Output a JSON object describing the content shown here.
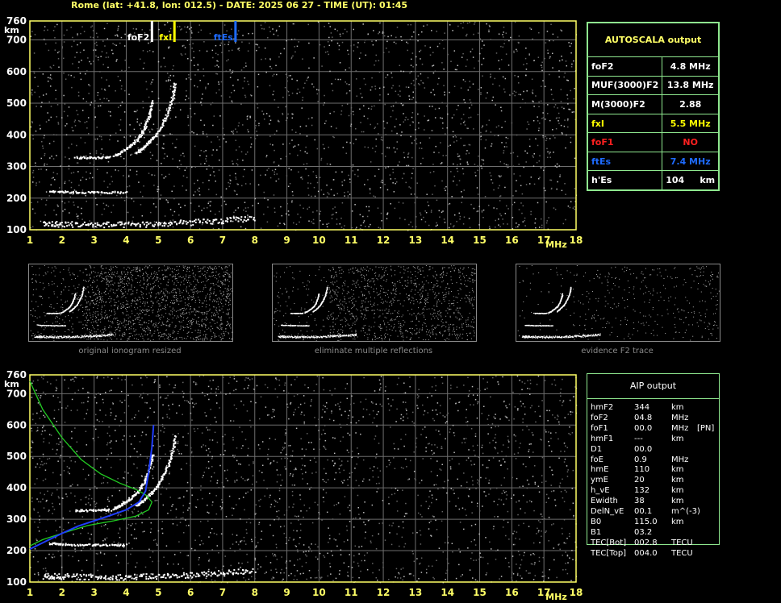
{
  "header": {
    "title": "Rome (lat: +41.8, lon: 012.5) - DATE: 2025 06 27 - TIME (UT): 01:45"
  },
  "colors": {
    "axis": "#ffff66",
    "grid": "#707070",
    "panel_border": "#8fe88f",
    "foF2": "#ffffff",
    "fxI": "#ffff00",
    "ftEs": "#1e6bff",
    "foF1": "#ff2020",
    "profile_green": "#22cc22",
    "profile_blue": "#1f3dff"
  },
  "autoscala": {
    "title": "AUTOSCALA output",
    "rows": [
      {
        "label": "foF2",
        "value": "4.8 MHz",
        "color": "#ffffff"
      },
      {
        "label": "MUF(3000)F2",
        "value": "13.8 MHz",
        "color": "#ffffff"
      },
      {
        "label": "M(3000)F2",
        "value": "2.88",
        "color": "#ffffff"
      },
      {
        "label": "fxI",
        "value": "5.5 MHz",
        "color": "#ffff00"
      },
      {
        "label": "foF1",
        "value": "NO",
        "color": "#ff2020"
      },
      {
        "label": "ftEs",
        "value": "7.4 MHz",
        "color": "#1e6bff"
      },
      {
        "label": "h'Es",
        "value": "104     km",
        "color": "#ffffff"
      }
    ]
  },
  "aip": {
    "title": "AIP output",
    "rows": [
      [
        "hmF2",
        "344",
        "km",
        ""
      ],
      [
        "foF2",
        "04.8",
        "MHz",
        ""
      ],
      [
        "foF1",
        "00.0",
        "MHz",
        "[PN]"
      ],
      [
        "hmF1",
        "---",
        "km",
        ""
      ],
      [
        "D1",
        "00.0",
        "",
        ""
      ],
      [
        "foE",
        "0.9",
        "MHz",
        ""
      ],
      [
        "hmE",
        "110",
        "km",
        ""
      ],
      [
        "ymE",
        "20",
        "km",
        ""
      ],
      [
        "h_vE",
        "132",
        "km",
        ""
      ],
      [
        "Ewidth",
        "38",
        "km",
        ""
      ],
      [
        "DelN_vE",
        "00.1",
        "m^(-3)",
        ""
      ],
      [
        "B0",
        "115.0",
        "km",
        ""
      ],
      [
        "B1",
        "03.2",
        "",
        ""
      ],
      [
        "TEC[Bot]",
        "002.8",
        "TECU",
        ""
      ],
      [
        "TEC[Top]",
        "004.0",
        "TECU",
        ""
      ]
    ]
  },
  "thumbnails": [
    {
      "caption": "original ionogram resized"
    },
    {
      "caption": "eliminate multiple reflections"
    },
    {
      "caption": "evidence F2 trace"
    }
  ],
  "chart_data": [
    {
      "type": "scatter",
      "title": "",
      "xlabel": "MHz",
      "ylabel": "km",
      "xlim": [
        1,
        18
      ],
      "ylim": [
        100,
        760
      ],
      "x_ticks": [
        1,
        2,
        3,
        4,
        5,
        6,
        7,
        8,
        9,
        10,
        11,
        12,
        13,
        14,
        15,
        16,
        17,
        18
      ],
      "y_ticks": [
        100,
        200,
        300,
        400,
        500,
        600,
        700,
        760
      ],
      "markers": [
        {
          "label": "foF2",
          "freq": 4.8,
          "color": "#ffffff"
        },
        {
          "label": "fxI",
          "freq": 5.5,
          "color": "#ffff00"
        },
        {
          "label": "ftEs",
          "freq": 7.4,
          "color": "#1e6bff"
        }
      ],
      "series": [
        {
          "type": "o_trace",
          "points": [
            [
              3.6,
              335
            ],
            [
              3.8,
              345
            ],
            [
              4.0,
              360
            ],
            [
              4.2,
              375
            ],
            [
              4.4,
              395
            ],
            [
              4.55,
              420
            ],
            [
              4.65,
              450
            ],
            [
              4.75,
              480
            ],
            [
              4.8,
              510
            ]
          ]
        },
        {
          "type": "x_trace",
          "points": [
            [
              4.3,
              345
            ],
            [
              4.5,
              360
            ],
            [
              4.7,
              380
            ],
            [
              4.9,
              400
            ],
            [
              5.05,
              425
            ],
            [
              5.2,
              455
            ],
            [
              5.35,
              490
            ],
            [
              5.45,
              530
            ],
            [
              5.5,
              570
            ]
          ]
        },
        {
          "type": "f_low",
          "points": [
            [
              2.4,
              330
            ],
            [
              2.8,
              330
            ],
            [
              3.2,
              330
            ],
            [
              3.5,
              332
            ]
          ]
        },
        {
          "type": "es_band",
          "points": [
            [
              1.6,
              225
            ],
            [
              2.0,
              222
            ],
            [
              2.5,
              220
            ],
            [
              3.0,
              220
            ],
            [
              3.5,
              220
            ],
            [
              4.0,
              220
            ]
          ]
        },
        {
          "type": "e_band",
          "points": [
            [
              1.4,
              120
            ],
            [
              2,
              120
            ],
            [
              3,
              118
            ],
            [
              4,
              118
            ],
            [
              5,
              120
            ],
            [
              6,
              125
            ],
            [
              7,
              130
            ],
            [
              8,
              140
            ]
          ]
        }
      ]
    },
    {
      "type": "line",
      "title": "",
      "xlabel": "MHz",
      "ylabel": "km",
      "xlim": [
        1,
        18
      ],
      "ylim": [
        100,
        760
      ],
      "x_ticks": [
        1,
        2,
        3,
        4,
        5,
        6,
        7,
        8,
        9,
        10,
        11,
        12,
        13,
        14,
        15,
        16,
        17,
        18
      ],
      "y_ticks": [
        100,
        200,
        300,
        400,
        500,
        600,
        700,
        760
      ],
      "series": [
        {
          "name": "",
          "color": "#22cc22",
          "points": [
            [
              1.0,
              740
            ],
            [
              1.4,
              650
            ],
            [
              2.0,
              560
            ],
            [
              2.6,
              490
            ],
            [
              3.2,
              445
            ],
            [
              3.8,
              415
            ],
            [
              4.3,
              395
            ],
            [
              4.6,
              378
            ],
            [
              4.8,
              355
            ],
            [
              4.7,
              330
            ],
            [
              4.3,
              310
            ],
            [
              3.6,
              295
            ],
            [
              2.8,
              280
            ],
            [
              2.0,
              255
            ],
            [
              1.4,
              235
            ],
            [
              1.0,
              215
            ]
          ]
        },
        {
          "name": "",
          "color": "#1f3dff",
          "points": [
            [
              1.0,
              205
            ],
            [
              1.5,
              230
            ],
            [
              2.0,
              255
            ],
            [
              2.5,
              278
            ],
            [
              3.0,
              295
            ],
            [
              3.5,
              312
            ],
            [
              4.0,
              330
            ],
            [
              4.4,
              355
            ],
            [
              4.6,
              390
            ],
            [
              4.7,
              450
            ],
            [
              4.8,
              530
            ],
            [
              4.85,
              600
            ]
          ]
        }
      ]
    }
  ]
}
